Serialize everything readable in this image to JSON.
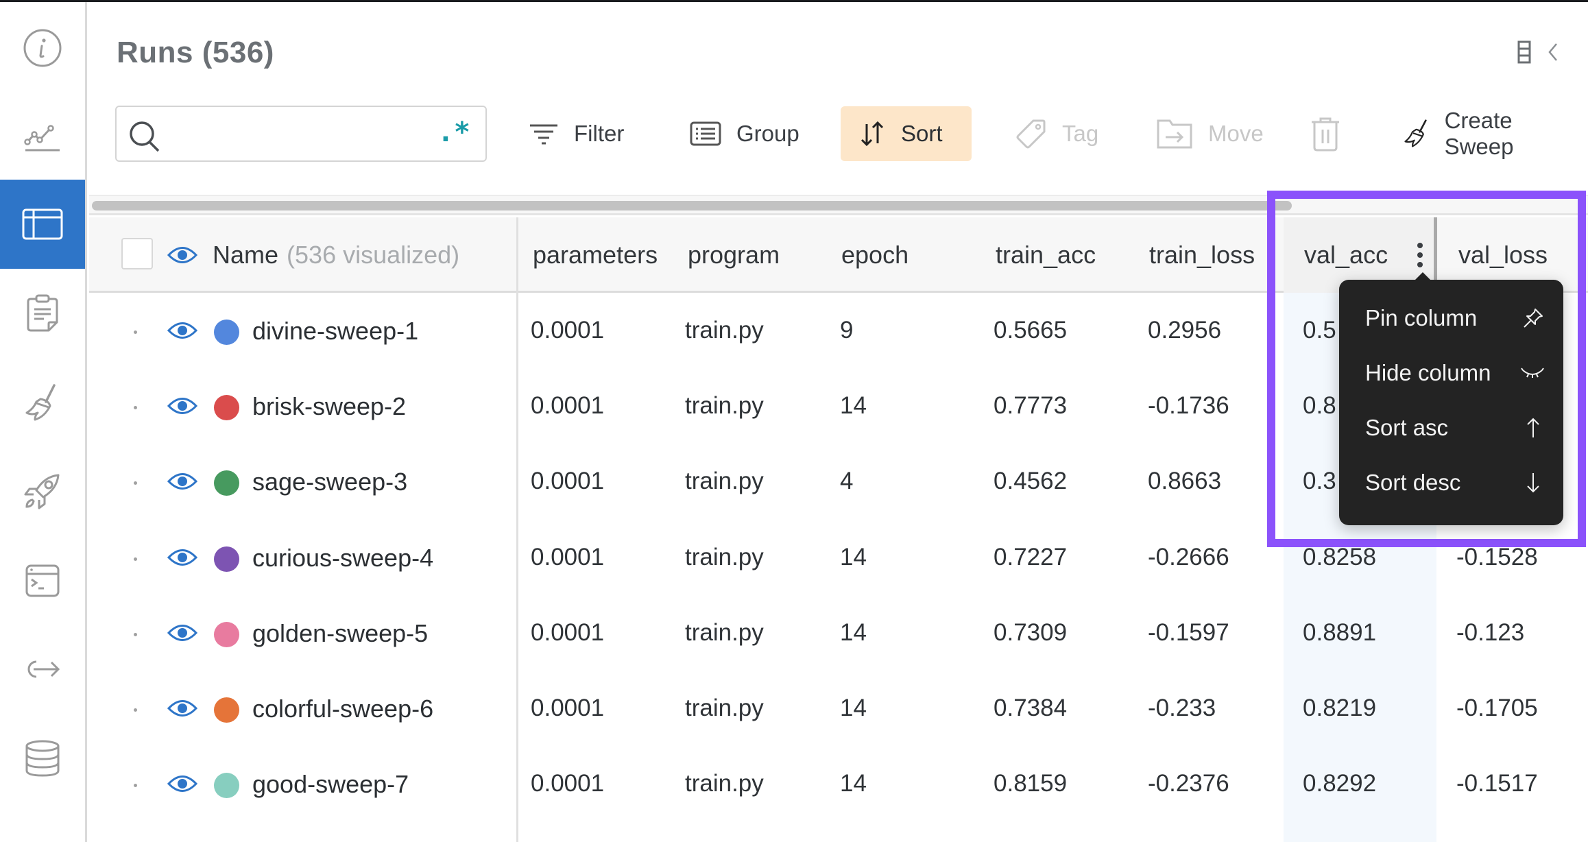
{
  "sidebar": {
    "items": [
      {
        "name": "info",
        "icon": "info-icon",
        "active": false
      },
      {
        "name": "charts",
        "icon": "line-chart-icon",
        "active": false
      },
      {
        "name": "runs-table",
        "icon": "table-icon",
        "active": true
      },
      {
        "name": "reports",
        "icon": "clipboard-icon",
        "active": false
      },
      {
        "name": "sweeps",
        "icon": "broom-icon",
        "active": false
      },
      {
        "name": "launch",
        "icon": "rocket-icon",
        "active": false
      },
      {
        "name": "jobs",
        "icon": "terminal-icon",
        "active": false
      },
      {
        "name": "automations",
        "icon": "arrow-out-icon",
        "active": false
      },
      {
        "name": "artifacts",
        "icon": "database-icon",
        "active": false
      }
    ]
  },
  "header": {
    "title": "Runs",
    "count": "(536)"
  },
  "toolbar": {
    "search_value": "",
    "search_placeholder": "",
    "regex_label": ".*",
    "filter_label": "Filter",
    "group_label": "Group",
    "sort_label": "Sort",
    "tag_label": "Tag",
    "move_label": "Move",
    "create_sweep_label": "Create Sweep"
  },
  "table": {
    "name_header": "Name",
    "name_header_suffix": "(536 visualized)",
    "columns": [
      "parameters",
      "program",
      "epoch",
      "train_acc",
      "train_loss",
      "val_acc",
      "val_loss"
    ],
    "rows": [
      {
        "name": "divine-sweep-1",
        "color": "#5387dd",
        "parameters": "0.0001",
        "program": "train.py",
        "epoch": "9",
        "train_acc": "0.5665",
        "train_loss": "0.2956",
        "val_acc": "0.5",
        "val_loss": ""
      },
      {
        "name": "brisk-sweep-2",
        "color": "#da4c4c",
        "parameters": "0.0001",
        "program": "train.py",
        "epoch": "14",
        "train_acc": "0.7773",
        "train_loss": "-0.1736",
        "val_acc": "0.8",
        "val_loss": ""
      },
      {
        "name": "sage-sweep-3",
        "color": "#479a5f",
        "parameters": "0.0001",
        "program": "train.py",
        "epoch": "4",
        "train_acc": "0.4562",
        "train_loss": "0.8663",
        "val_acc": "0.3",
        "val_loss": ""
      },
      {
        "name": "curious-sweep-4",
        "color": "#7d54b2",
        "parameters": "0.0001",
        "program": "train.py",
        "epoch": "14",
        "train_acc": "0.7227",
        "train_loss": "-0.2666",
        "val_acc": "0.8258",
        "val_loss": "-0.1528"
      },
      {
        "name": "golden-sweep-5",
        "color": "#e87b9f",
        "parameters": "0.0001",
        "program": "train.py",
        "epoch": "14",
        "train_acc": "0.7309",
        "train_loss": "-0.1597",
        "val_acc": "0.8891",
        "val_loss": "-0.123"
      },
      {
        "name": "colorful-sweep-6",
        "color": "#e57439",
        "parameters": "0.0001",
        "program": "train.py",
        "epoch": "14",
        "train_acc": "0.7384",
        "train_loss": "-0.233",
        "val_acc": "0.8219",
        "val_loss": "-0.1705"
      },
      {
        "name": "good-sweep-7",
        "color": "#87cebf",
        "parameters": "0.0001",
        "program": "train.py",
        "epoch": "14",
        "train_acc": "0.8159",
        "train_loss": "-0.2376",
        "val_acc": "0.8292",
        "val_loss": "-0.1517"
      }
    ]
  },
  "column_menu": {
    "column": "val_acc",
    "items": [
      {
        "label": "Pin column",
        "icon": "pin-icon"
      },
      {
        "label": "Hide column",
        "icon": "eye-closed-icon"
      },
      {
        "label": "Sort asc",
        "icon": "arrow-up-icon"
      },
      {
        "label": "Sort desc",
        "icon": "arrow-down-icon"
      }
    ]
  },
  "colors": {
    "accent": "#2e75c8",
    "highlight": "#8b52fb",
    "sort_active_bg": "#fde6c9",
    "regex": "#1a9ba8",
    "menu_bg": "#232323"
  }
}
